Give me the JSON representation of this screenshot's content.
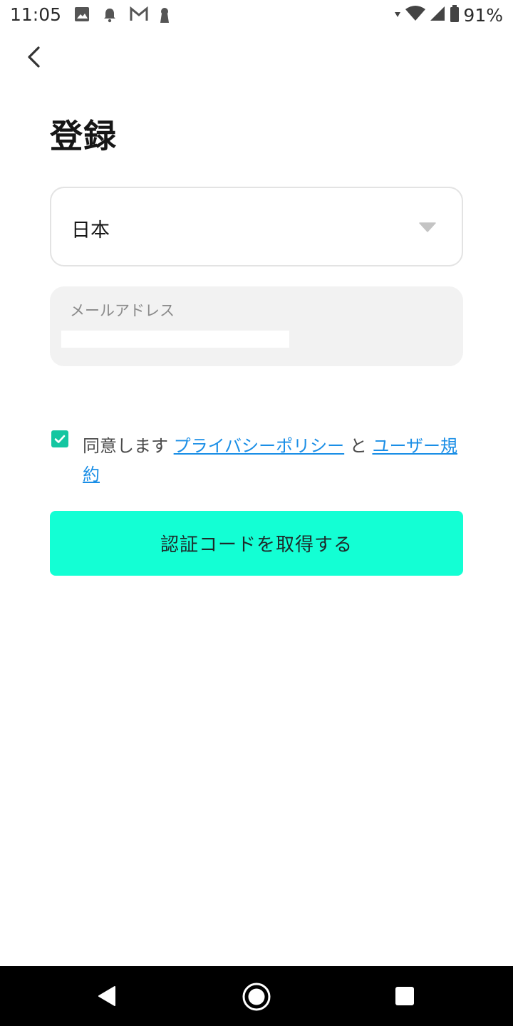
{
  "status_bar": {
    "time": "11:05",
    "battery": "91%",
    "left_icons": [
      "image-icon",
      "notification-bell-icon",
      "gmail-icon",
      "keyhole-icon"
    ],
    "right_icons": [
      "data-arrow-icon",
      "wifi-icon",
      "signal-icon",
      "battery-icon"
    ]
  },
  "header": {
    "back_icon": "chevron-left-icon",
    "title": "登録"
  },
  "form": {
    "country": {
      "value": "日本",
      "icon": "triangle-down-icon"
    },
    "email": {
      "label": "メールアドレス",
      "value": ""
    },
    "agreement": {
      "checked": true,
      "prefix": "同意します",
      "privacy_link": "プライバシーポリシー",
      "conjunction": "と",
      "terms_link": "ユーザー規約"
    },
    "submit_label": "認証コードを取得する"
  },
  "nav_bar": {
    "icons": [
      "back-triangle-icon",
      "home-circle-icon",
      "recents-square-icon"
    ]
  },
  "colors": {
    "accent": "#13ffd4",
    "checkbox": "#14c6a1",
    "link": "#1a8ee6",
    "field_bg": "#f2f2f2"
  }
}
